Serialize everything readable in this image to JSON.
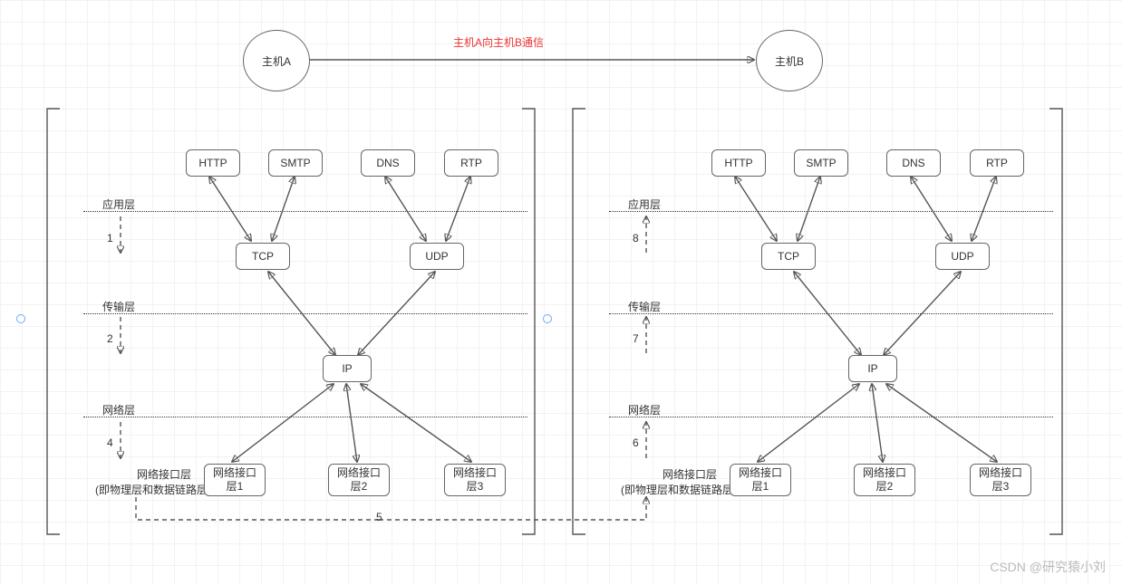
{
  "title_red": "主机A向主机B通信",
  "host_a": "主机A",
  "host_b": "主机B",
  "layers": {
    "application": "应用层",
    "transport": "传输层",
    "network": "网络层",
    "iface": "网络接口层",
    "iface_note": "(即物理层和数据链路层两层)"
  },
  "protos": {
    "http": "HTTP",
    "smtp": "SMTP",
    "dns": "DNS",
    "rtp": "RTP",
    "tcp": "TCP",
    "udp": "UDP",
    "ip": "IP",
    "iface1": "网络接口层1",
    "iface2": "网络接口层2",
    "iface3": "网络接口层3"
  },
  "steps": {
    "s1": "1",
    "s2": "2",
    "s4": "4",
    "s5": "5",
    "s6": "6",
    "s7": "7",
    "s8": "8"
  },
  "watermark": "CSDN @研究猿小刘"
}
